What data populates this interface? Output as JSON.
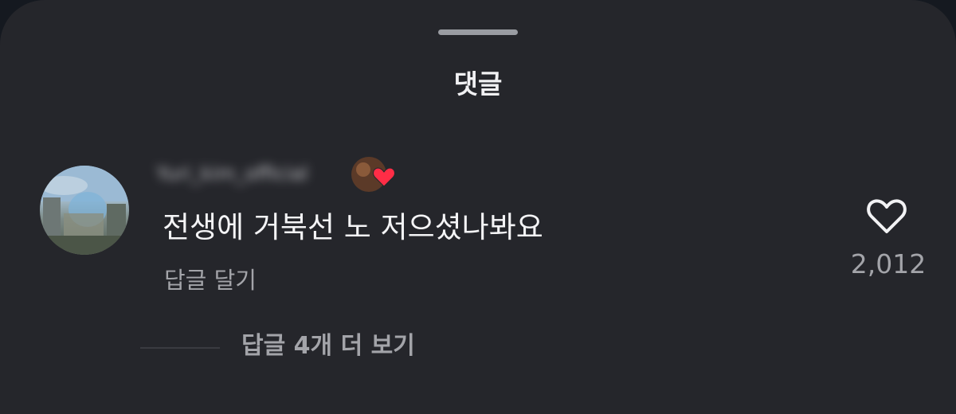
{
  "sheet": {
    "title": "댓글"
  },
  "comment": {
    "username": "Yuri_kim_official",
    "text": "전생에 거북선 노 저으셨나봐요",
    "reply_label": "답글 달기",
    "like_count": "2,012",
    "like_icon": "heart-outline-icon",
    "badge_icon": "heart-icon",
    "badge_color": "#ff2d46"
  },
  "replies": {
    "more_label": "답글 4개 더 보기"
  }
}
